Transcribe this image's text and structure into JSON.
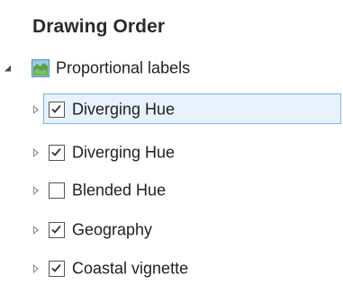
{
  "panel": {
    "title": "Drawing Order"
  },
  "map": {
    "label": "Proportional labels",
    "expanded": true,
    "icon": "map-icon"
  },
  "layers": [
    {
      "label": "Diverging Hue",
      "checked": true,
      "selected": true,
      "expanded": false
    },
    {
      "label": "Diverging Hue",
      "checked": true,
      "selected": false,
      "expanded": false
    },
    {
      "label": "Blended Hue",
      "checked": false,
      "selected": false,
      "expanded": false
    },
    {
      "label": "Geography",
      "checked": true,
      "selected": false,
      "expanded": false
    },
    {
      "label": "Coastal vignette",
      "checked": true,
      "selected": false,
      "expanded": false
    }
  ],
  "colors": {
    "selection_fill": "#e8f2fc",
    "selection_border": "#7ab4ea",
    "map_icon_green": "#5aa04a",
    "map_icon_blue": "#9ccbe6"
  }
}
